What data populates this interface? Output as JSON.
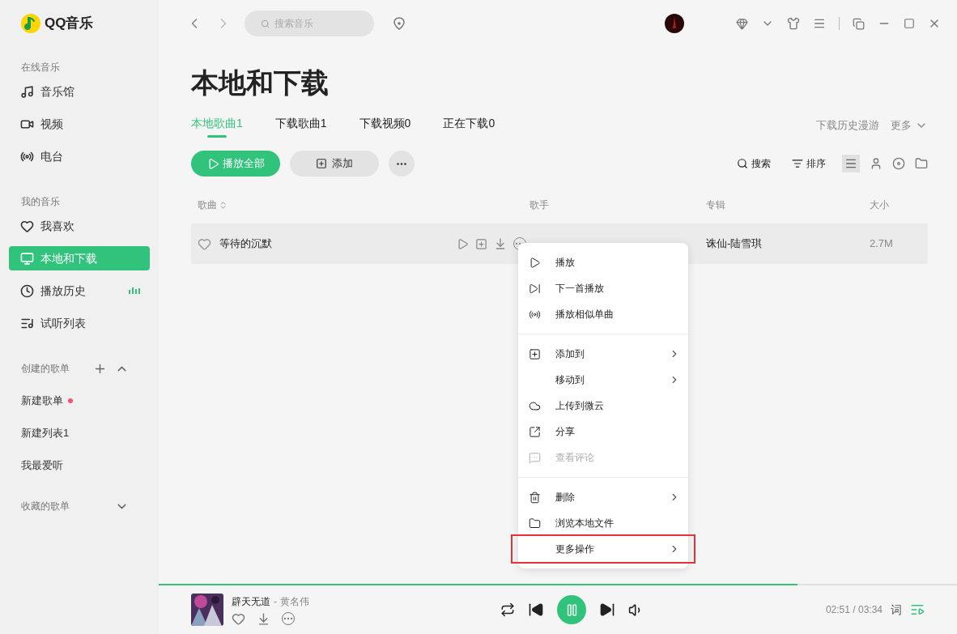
{
  "app": {
    "name": "QQ音乐"
  },
  "sidebar": {
    "sections": [
      {
        "title": "在线音乐",
        "items": [
          {
            "label": "音乐馆",
            "selected": false
          },
          {
            "label": "视频",
            "selected": false
          },
          {
            "label": "电台",
            "selected": false
          }
        ]
      },
      {
        "title": "我的音乐",
        "items": [
          {
            "label": "我喜欢",
            "selected": false
          },
          {
            "label": "本地和下载",
            "selected": true
          },
          {
            "label": "播放历史",
            "selected": false,
            "playing": true
          },
          {
            "label": "试听列表",
            "selected": false
          }
        ]
      }
    ],
    "created": {
      "title": "创建的歌单",
      "expanded": true,
      "items": [
        {
          "label": "新建歌单",
          "dot": true
        },
        {
          "label": "新建列表1",
          "dot": false
        },
        {
          "label": "我最爱听",
          "dot": false
        }
      ]
    },
    "collected": {
      "title": "收藏的歌单",
      "expanded": false
    }
  },
  "topbar": {
    "search": {
      "placeholder": "搜索音乐"
    }
  },
  "page": {
    "title": "本地和下载",
    "tabs": [
      {
        "label": "本地歌曲1",
        "selected": true
      },
      {
        "label": "下载歌曲1",
        "selected": false
      },
      {
        "label": "下载视频0",
        "selected": false
      },
      {
        "label": "正在下载0",
        "selected": false
      }
    ],
    "links": [
      "下载历史漫游",
      "更多"
    ],
    "actions": {
      "play_all": "播放全部",
      "add": "添加"
    },
    "tools": [
      "搜索",
      "排序"
    ],
    "table": {
      "columns": [
        "歌曲",
        "歌手",
        "专辑",
        "大小"
      ],
      "rows": [
        {
          "title": "等待的沉默",
          "liked": false,
          "album": "诛仙-陆雪琪",
          "size": "2.7M"
        }
      ]
    }
  },
  "context_menu": {
    "groups": [
      [
        {
          "label": "播放",
          "submenu": false,
          "disabled": false,
          "highlighted": false
        },
        {
          "label": "下一首播放",
          "submenu": false,
          "disabled": false,
          "highlighted": false
        },
        {
          "label": "播放相似单曲",
          "submenu": false,
          "disabled": false,
          "highlighted": false
        }
      ],
      [
        {
          "label": "添加到",
          "submenu": true,
          "disabled": false,
          "highlighted": false
        },
        {
          "label": "移动到",
          "submenu": true,
          "disabled": false,
          "highlighted": false
        },
        {
          "label": "上传到微云",
          "submenu": false,
          "disabled": false,
          "highlighted": false
        },
        {
          "label": "分享",
          "submenu": false,
          "disabled": false,
          "highlighted": false
        },
        {
          "label": "查看评论",
          "submenu": false,
          "disabled": true,
          "highlighted": false
        }
      ],
      [
        {
          "label": "删除",
          "submenu": true,
          "disabled": false,
          "highlighted": false
        },
        {
          "label": "浏览本地文件",
          "submenu": false,
          "disabled": false,
          "highlighted": false
        },
        {
          "label": "更多操作",
          "submenu": true,
          "disabled": false,
          "highlighted": true
        }
      ]
    ]
  },
  "player": {
    "level": 0.8,
    "title": "辟天无道",
    "separator": "-",
    "artist": "黄名伟",
    "playing": true,
    "time": "02:51 / 03:34",
    "lyrics": "词"
  }
}
